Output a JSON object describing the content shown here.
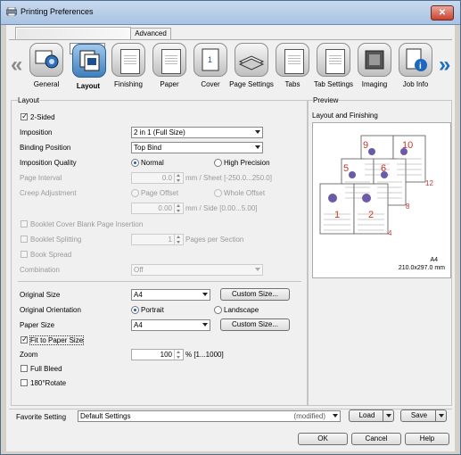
{
  "window": {
    "title": "Printing Preferences",
    "close_label": "✕"
  },
  "tabs": [
    {
      "label": ""
    },
    {
      "label": "Advanced"
    }
  ],
  "toolbar": {
    "items": [
      {
        "label": "General"
      },
      {
        "label": "Layout"
      },
      {
        "label": "Finishing"
      },
      {
        "label": "Paper"
      },
      {
        "label": "Cover"
      },
      {
        "label": "Page Settings"
      },
      {
        "label": "Tabs"
      },
      {
        "label": "Tab Settings"
      },
      {
        "label": "Imaging"
      },
      {
        "label": "Job Info"
      }
    ]
  },
  "layout": {
    "group_title": "Layout",
    "two_sided": {
      "label": "2-Sided",
      "checked": true
    },
    "imposition": {
      "label": "Imposition",
      "value": "2 in 1 (Full Size)"
    },
    "binding": {
      "label": "Binding Position",
      "value": "Top Bind"
    },
    "quality": {
      "label": "Imposition Quality",
      "opt1": "Normal",
      "opt2": "High Precision"
    },
    "page_interval": {
      "label": "Page Interval",
      "value": "0.0",
      "unit": "mm / Sheet [-250.0...250.0]"
    },
    "creep": {
      "label": "Creep Adjustment",
      "opt1": "Page Offset",
      "opt2": "Whole Offset",
      "value": "0.00",
      "unit": "mm / Side [0.00...5.00]"
    },
    "booklet_cover": {
      "label": "Booklet Cover Blank Page Insertion"
    },
    "booklet_split": {
      "label": "Booklet Splitting",
      "value": "1",
      "unit": "Pages per Section"
    },
    "book_spread": {
      "label": "Book Spread"
    },
    "combination": {
      "label": "Combination",
      "value": "Off"
    },
    "original_size": {
      "label": "Original Size",
      "value": "A4",
      "button": "Custom Size..."
    },
    "orientation": {
      "label": "Original Orientation",
      "opt1": "Portrait",
      "opt2": "Landscape"
    },
    "paper_size": {
      "label": "Paper Size",
      "value": "A4",
      "button": "Custom Size..."
    },
    "fit": {
      "label": "Fit to Paper Size"
    },
    "zoom": {
      "label": "Zoom",
      "value": "100",
      "unit": "% [1...1000]"
    },
    "full_bleed": {
      "label": "Full Bleed"
    },
    "rotate": {
      "label": "180°Rotate"
    }
  },
  "preview": {
    "group_title": "Preview",
    "subtitle": "Layout and Finishing",
    "paper": "A4",
    "dims": "210.0x297.0 mm",
    "page_numbers": [
      "9",
      "10",
      "5",
      "6",
      "1",
      "2",
      "12",
      "8",
      "4"
    ]
  },
  "footer": {
    "favorite_label": "Favorite Setting",
    "favorite_value": "Default Settings",
    "modified": "(modified)",
    "load": "Load",
    "save": "Save",
    "ok": "OK",
    "cancel": "Cancel",
    "help": "Help"
  }
}
